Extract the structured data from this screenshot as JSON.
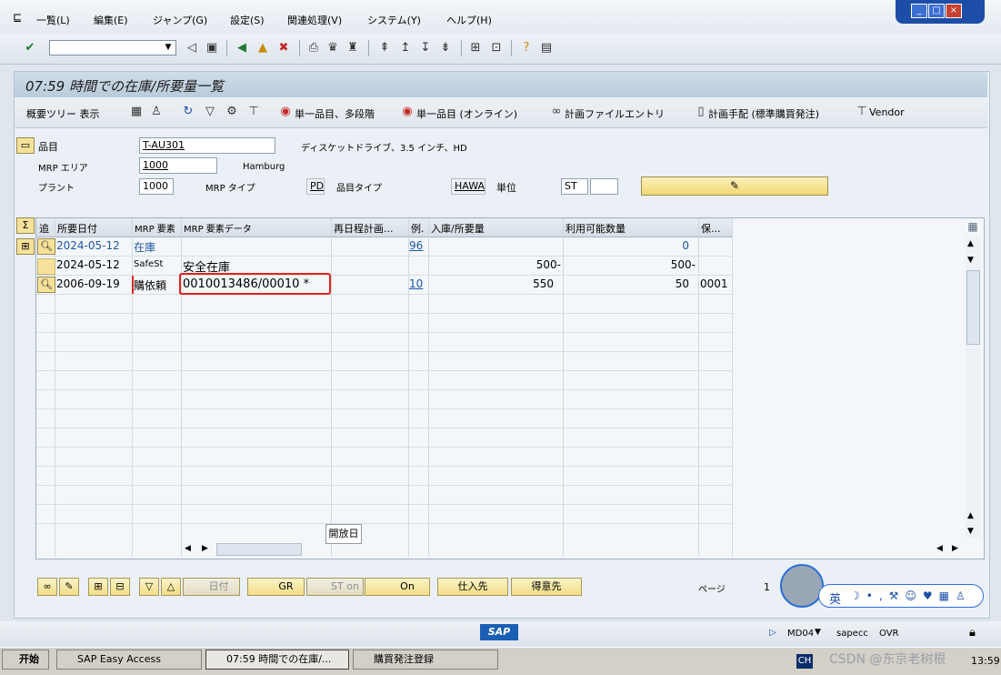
{
  "menu": {
    "items": [
      "一覧(L)",
      "編集(E)",
      "ジャンプ(G)",
      "設定(S)",
      "関連処理(V)",
      "システム(Y)",
      "ヘルプ(H)"
    ]
  },
  "window_controls": {
    "minimize": "_",
    "restore": "□",
    "close": "×"
  },
  "title": "07:59 時間での在庫/所要量一覧",
  "app_toolbar": {
    "tree_toggle": "概要ツリー 表示",
    "single_item_multi": "単一品目、多段階",
    "single_item_online": "単一品目 (オンライン)",
    "plan_file_entry": "計画ファイルエントリ",
    "plan_procedure": "計画手配 (標準購買発注)",
    "vendor": "Vendor"
  },
  "header": {
    "material_label": "品目",
    "material_value": "T-AU301",
    "material_desc": "ディスケットドライブ、3.5 インチ、HD",
    "mrp_area_label": "MRP エリア",
    "mrp_area_value": "1000",
    "mrp_area_name": "Hamburg",
    "plant_label": "プラント",
    "plant_value": "1000",
    "mrp_type_label": "MRP タイプ",
    "mrp_type_value": "PD",
    "material_type_label": "品目タイプ",
    "material_type_value": "HAWA",
    "unit_label": "単位",
    "unit_value": "ST"
  },
  "grid": {
    "columns": [
      "追",
      "所要日付",
      "MRP 要素",
      "MRP 要素データ",
      "再日程計画...",
      "例.",
      "入庫/所要量",
      "利用可能数量",
      "保..."
    ],
    "rows": [
      {
        "date": "2024-05-12",
        "element": "在庫",
        "data": "",
        "exception": "96",
        "qty": "",
        "available": "0",
        "storage": ""
      },
      {
        "date": "2024-05-12",
        "element": "SafeSt",
        "data": "安全在庫",
        "exception": "",
        "qty": "500-",
        "available": "500-",
        "storage": ""
      },
      {
        "date": "2006-09-19",
        "element": "購依頼",
        "data": "0010013486/00010 *",
        "exception": "10",
        "qty": "550",
        "available": "50",
        "storage": "0001"
      }
    ],
    "tooltip": "開放日"
  },
  "bottom_buttons": {
    "date": "日付",
    "gr": "GR",
    "st_on": "ST on",
    "on": "On",
    "vendor": "仕入先",
    "customer": "得意先",
    "page_label": "ページ",
    "page_value": "1"
  },
  "status": {
    "transaction": "MD04",
    "server": "sapecc",
    "mode": "OVR",
    "ime": "英"
  },
  "taskbar": {
    "start": "开始",
    "tasks": [
      "SAP Easy Access",
      "07:59 時間での在庫/...",
      "購買発注登録"
    ],
    "lang": "CH",
    "watermark": "CSDN @东京老树根",
    "clock": "13:59"
  },
  "colors": {
    "accent": "#1c4ea7",
    "highlight": "#e0241c",
    "button": "#f2de86"
  }
}
